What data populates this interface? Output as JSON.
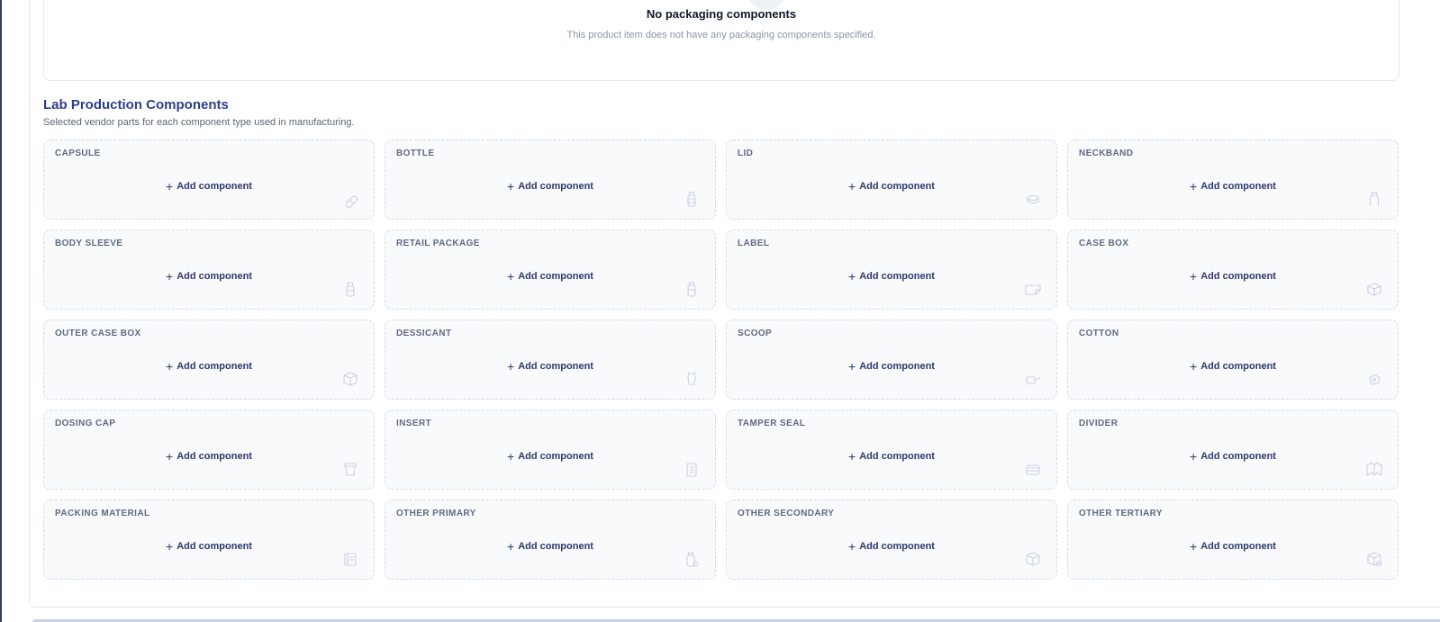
{
  "empty_state": {
    "title": "No packaging components",
    "subtitle": "This product item does not have any packaging components specified."
  },
  "lab_section": {
    "title": "Lab Production Components",
    "subtitle": "Selected vendor parts for each component type used in manufacturing."
  },
  "add_label": "Add component",
  "components": [
    {
      "label": "CAPSULE",
      "icon": "capsule-icon"
    },
    {
      "label": "BOTTLE",
      "icon": "bottle-icon"
    },
    {
      "label": "LID",
      "icon": "lid-icon"
    },
    {
      "label": "NECKBAND",
      "icon": "neckband-icon"
    },
    {
      "label": "BODY SLEEVE",
      "icon": "sleeve-icon"
    },
    {
      "label": "RETAIL PACKAGE",
      "icon": "package-icon"
    },
    {
      "label": "LABEL",
      "icon": "label-icon"
    },
    {
      "label": "CASE BOX",
      "icon": "box-icon"
    },
    {
      "label": "OUTER CASE BOX",
      "icon": "box-3d-icon"
    },
    {
      "label": "DESSICANT",
      "icon": "desiccant-icon"
    },
    {
      "label": "SCOOP",
      "icon": "scoop-icon"
    },
    {
      "label": "COTTON",
      "icon": "cotton-icon"
    },
    {
      "label": "DOSING CAP",
      "icon": "cap-icon"
    },
    {
      "label": "INSERT",
      "icon": "insert-icon"
    },
    {
      "label": "TAMPER SEAL",
      "icon": "seal-icon"
    },
    {
      "label": "DIVIDER",
      "icon": "divider-icon"
    },
    {
      "label": "PACKING MATERIAL",
      "icon": "packing-icon"
    },
    {
      "label": "OTHER PRIMARY",
      "icon": "primary-icon"
    },
    {
      "label": "OTHER SECONDARY",
      "icon": "secondary-icon"
    },
    {
      "label": "OTHER TERTIARY",
      "icon": "tertiary-icon"
    }
  ],
  "colors": {
    "accent": "#2e3f8a",
    "card_bg": "#f8fafc",
    "card_border": "#d6dce7",
    "icon_stroke": "#cbd3df"
  }
}
